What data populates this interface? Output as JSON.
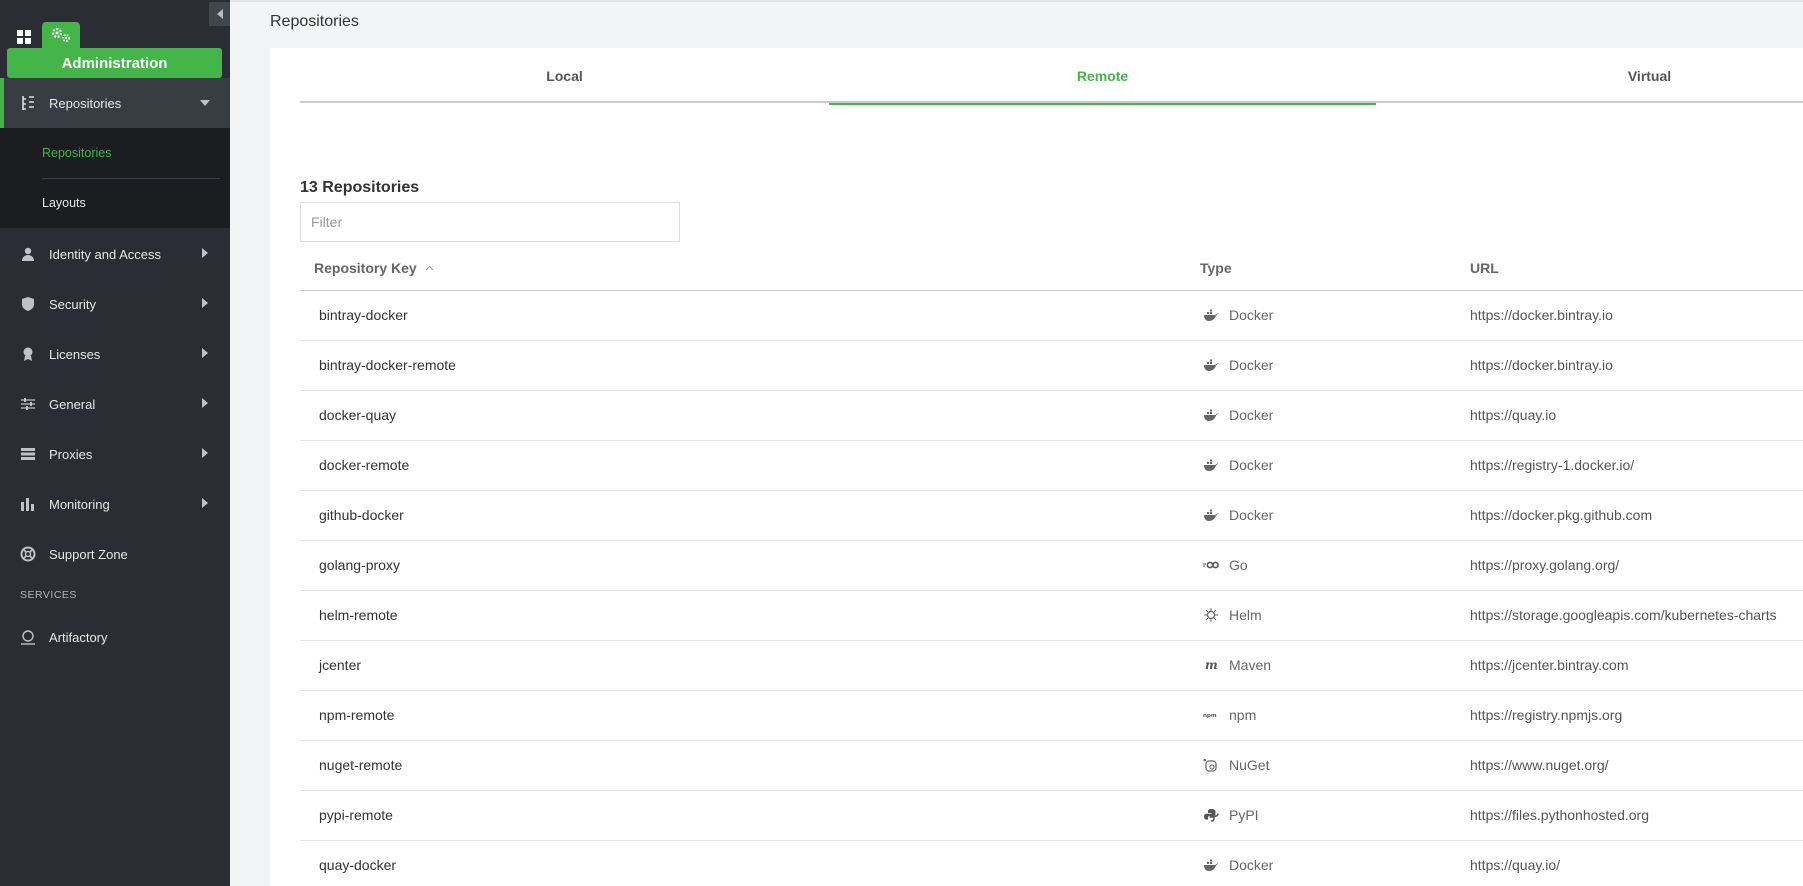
{
  "sidebar": {
    "admin_label": "Administration",
    "nav": [
      {
        "label": "Repositories",
        "icon": "repositories-icon"
      },
      {
        "label": "Identity and Access",
        "icon": "user-icon"
      },
      {
        "label": "Security",
        "icon": "shield-icon"
      },
      {
        "label": "Licenses",
        "icon": "license-icon"
      },
      {
        "label": "General",
        "icon": "sliders-icon"
      },
      {
        "label": "Proxies",
        "icon": "server-icon"
      },
      {
        "label": "Monitoring",
        "icon": "bar-chart-icon"
      },
      {
        "label": "Support Zone",
        "icon": "support-icon"
      }
    ],
    "subnav": [
      "Repositories",
      "Layouts"
    ],
    "services_label": "SERVICES",
    "services": [
      {
        "label": "Artifactory",
        "icon": "artifactory-icon"
      }
    ]
  },
  "page": {
    "title": "Repositories",
    "tabs": [
      "Local",
      "Remote",
      "Virtual"
    ],
    "active_tab": "Remote",
    "count_label": "13 Repositories",
    "filter_placeholder": "Filter"
  },
  "table": {
    "headers": {
      "key": "Repository Key",
      "type": "Type",
      "url": "URL"
    },
    "rows": [
      {
        "key": "bintray-docker",
        "type": "Docker",
        "url": "https://docker.bintray.io"
      },
      {
        "key": "bintray-docker-remote",
        "type": "Docker",
        "url": "https://docker.bintray.io"
      },
      {
        "key": "docker-quay",
        "type": "Docker",
        "url": "https://quay.io"
      },
      {
        "key": "docker-remote",
        "type": "Docker",
        "url": "https://registry-1.docker.io/"
      },
      {
        "key": "github-docker",
        "type": "Docker",
        "url": "https://docker.pkg.github.com"
      },
      {
        "key": "golang-proxy",
        "type": "Go",
        "url": "https://proxy.golang.org/"
      },
      {
        "key": "helm-remote",
        "type": "Helm",
        "url": "https://storage.googleapis.com/kubernetes-charts"
      },
      {
        "key": "jcenter",
        "type": "Maven",
        "url": "https://jcenter.bintray.com"
      },
      {
        "key": "npm-remote",
        "type": "npm",
        "url": "https://registry.npmjs.org"
      },
      {
        "key": "nuget-remote",
        "type": "NuGet",
        "url": "https://www.nuget.org/"
      },
      {
        "key": "pypi-remote",
        "type": "PyPI",
        "url": "https://files.pythonhosted.org"
      },
      {
        "key": "quay-docker",
        "type": "Docker",
        "url": "https://quay.io/"
      }
    ]
  },
  "colors": {
    "accent": "#43b549",
    "sidebar_bg": "#2a2d33",
    "subnav_bg": "#1b1d21"
  }
}
